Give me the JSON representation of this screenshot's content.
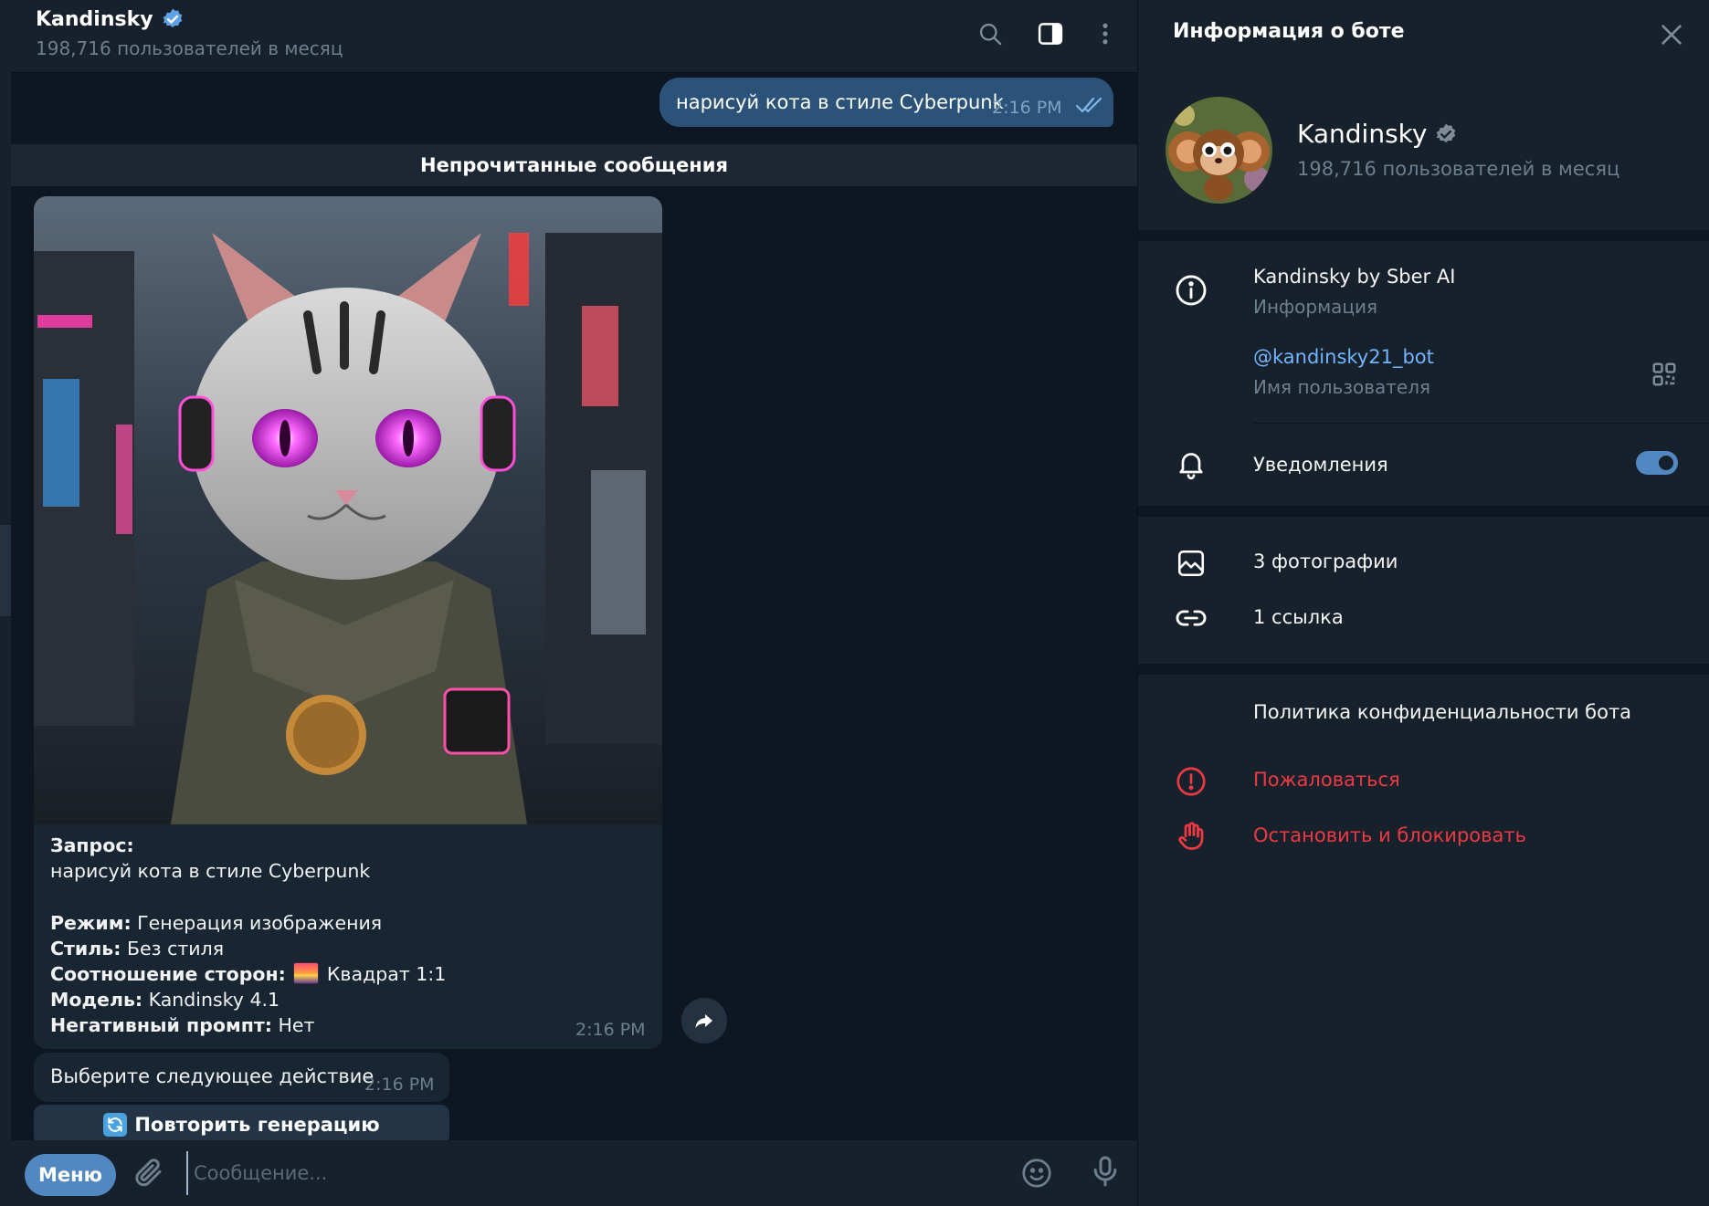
{
  "chat": {
    "title": "Kandinsky",
    "subtitle": "198,716 пользователей в месяц",
    "outgoing": {
      "text": "нарисуй кота в стиле Cyberpunk",
      "time": "2:16 PM"
    },
    "unread_label": "Непрочитанные сообщения",
    "photo_message": {
      "caption": {
        "request_label": "Запрос:",
        "request_text": "нарисуй кота в стиле Cyberpunk",
        "mode_label": "Режим:",
        "mode_value": " Генерация изображения",
        "style_label": "Стиль:",
        "style_value": " Без стиля",
        "ratio_label": "Соотношение сторон:",
        "ratio_value": " Квадрат 1:1",
        "model_label": "Модель:",
        "model_value": " Kandinsky 4.1",
        "negative_label": "Негативный промпт:",
        "negative_value": " Нет"
      },
      "time": "2:16 PM"
    },
    "action_message": {
      "text": "Выберите следующее действие",
      "time": "2:16 PM"
    },
    "inline_button": "Повторить генерацию",
    "composer": {
      "menu_label": "Меню",
      "placeholder": "Сообщение..."
    }
  },
  "info_panel": {
    "title": "Информация о боте",
    "bot_name": "Kandinsky",
    "bot_sub": "198,716 пользователей в месяц",
    "about_text": "Kandinsky by Sber AI",
    "about_label": "Информация",
    "username": "@kandinsky21_bot",
    "username_label": "Имя пользователя",
    "notifications_label": "Уведомления",
    "notifications_on": true,
    "photos_label": "3 фотографии",
    "links_label": "1 ссылка",
    "privacy_label": "Политика конфиденциальности бота",
    "report_label": "Пожаловаться",
    "block_label": "Остановить и блокировать"
  },
  "colors": {
    "accent": "#5288c1",
    "outgoing_bubble": "#2b5278",
    "danger": "#ec3942",
    "link": "#72b5ff"
  },
  "icons": [
    "search-icon",
    "sidebar-toggle-icon",
    "more-vertical-icon",
    "verified-icon",
    "double-check-icon",
    "share-icon",
    "refresh-icon",
    "paperclip-icon",
    "emoji-icon",
    "microphone-icon",
    "close-icon",
    "info-icon",
    "qr-code-icon",
    "bell-icon",
    "photo-icon",
    "link-icon",
    "warning-icon",
    "hand-stop-icon"
  ]
}
